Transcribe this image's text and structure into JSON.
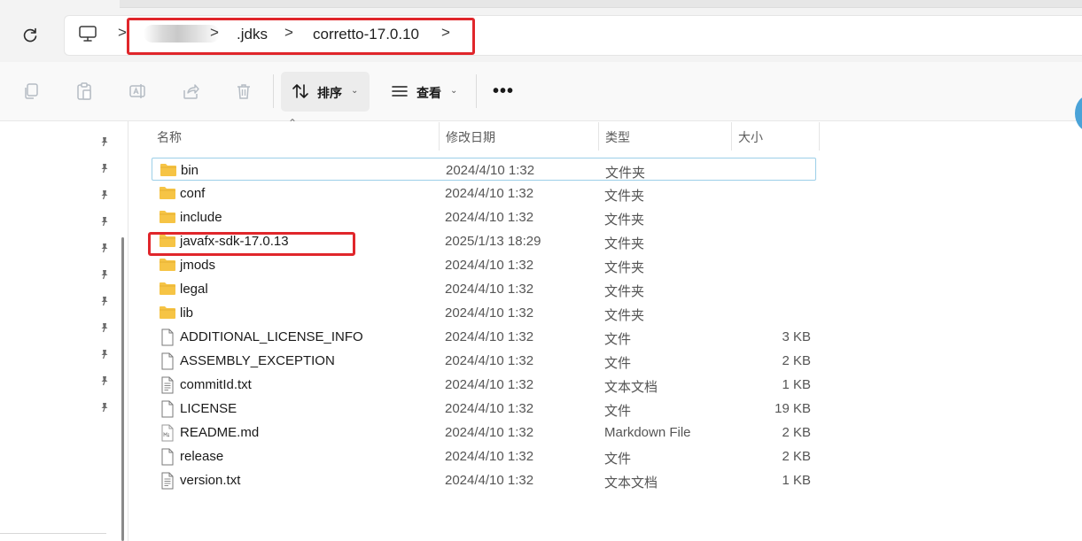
{
  "address_bar": {
    "crumbs": [
      ".jdks",
      "corretto-17.0.10"
    ],
    "separator": ">"
  },
  "toolbar": {
    "sort_label": "排序",
    "view_label": "查看",
    "more_label": "•••"
  },
  "columns": {
    "name": "名称",
    "date": "修改日期",
    "type": "类型",
    "size": "大小"
  },
  "files": [
    {
      "name": "bin",
      "date": "2024/4/10 1:32",
      "type": "文件夹",
      "size": "",
      "icon": "folder-icon"
    },
    {
      "name": "conf",
      "date": "2024/4/10 1:32",
      "type": "文件夹",
      "size": "",
      "icon": "folder-icon"
    },
    {
      "name": "include",
      "date": "2024/4/10 1:32",
      "type": "文件夹",
      "size": "",
      "icon": "folder-icon"
    },
    {
      "name": "javafx-sdk-17.0.13",
      "date": "2025/1/13 18:29",
      "type": "文件夹",
      "size": "",
      "icon": "folder-icon"
    },
    {
      "name": "jmods",
      "date": "2024/4/10 1:32",
      "type": "文件夹",
      "size": "",
      "icon": "folder-icon"
    },
    {
      "name": "legal",
      "date": "2024/4/10 1:32",
      "type": "文件夹",
      "size": "",
      "icon": "folder-icon"
    },
    {
      "name": "lib",
      "date": "2024/4/10 1:32",
      "type": "文件夹",
      "size": "",
      "icon": "folder-icon"
    },
    {
      "name": "ADDITIONAL_LICENSE_INFO",
      "date": "2024/4/10 1:32",
      "type": "文件",
      "size": "3 KB",
      "icon": "file-icon"
    },
    {
      "name": "ASSEMBLY_EXCEPTION",
      "date": "2024/4/10 1:32",
      "type": "文件",
      "size": "2 KB",
      "icon": "file-icon"
    },
    {
      "name": "commitId.txt",
      "date": "2024/4/10 1:32",
      "type": "文本文档",
      "size": "1 KB",
      "icon": "text-file-icon"
    },
    {
      "name": "LICENSE",
      "date": "2024/4/10 1:32",
      "type": "文件",
      "size": "19 KB",
      "icon": "file-icon"
    },
    {
      "name": "README.md",
      "date": "2024/4/10 1:32",
      "type": "Markdown File",
      "size": "2 KB",
      "icon": "markdown-file-icon"
    },
    {
      "name": "release",
      "date": "2024/4/10 1:32",
      "type": "文件",
      "size": "2 KB",
      "icon": "file-icon"
    },
    {
      "name": "version.txt",
      "date": "2024/4/10 1:32",
      "type": "文本文档",
      "size": "1 KB",
      "icon": "text-file-icon"
    }
  ],
  "colors": {
    "highlight_red": "#e0262b",
    "folder_yellow": "#f6c445",
    "selection_border": "#9ccfe8"
  }
}
